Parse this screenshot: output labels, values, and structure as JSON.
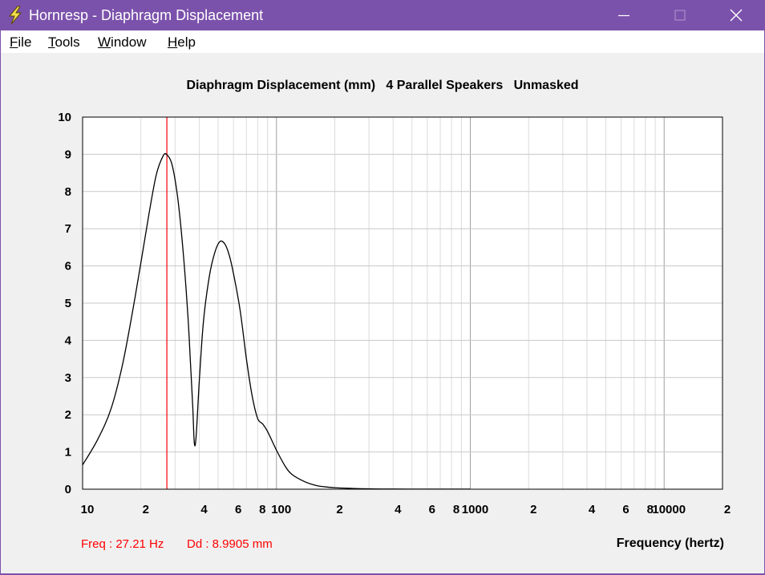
{
  "window": {
    "title": "Hornresp - Diaphragm Displacement",
    "icon": "lightning-bolt-icon",
    "controls": [
      "minimize-icon",
      "maximize-icon",
      "close-icon"
    ]
  },
  "menu": {
    "items": [
      {
        "label": "File",
        "accel": "F",
        "rest": "ile"
      },
      {
        "label": "Tools",
        "accel": "T",
        "rest": "ools"
      },
      {
        "label": "Window",
        "accel": "W",
        "rest": "indow"
      },
      {
        "label": "Help",
        "accel": "H",
        "rest": "elp"
      }
    ]
  },
  "colors": {
    "titlebar": "#7b52ab",
    "plot_bg": "#ffffff",
    "grid": "#c8c8c8",
    "curve": "#000000",
    "cursor": "#ff0000",
    "readout": "#ff0000"
  },
  "readout": {
    "freq": "Freq : 27.21 Hz",
    "dd": "Dd : 8.9905 mm"
  },
  "chart_data": {
    "type": "line",
    "title": "Diaphragm Displacement (mm)   4 Parallel Speakers   Unmasked",
    "xlabel": "Frequency (hertz)",
    "ylabel": "",
    "x_scale": "log",
    "xlim": [
      10,
      20000
    ],
    "ylim": [
      0,
      10
    ],
    "grid": true,
    "cursor_x": 27.21,
    "x_tick_labels": [
      {
        "v": 10,
        "t": "10"
      },
      {
        "v": 20,
        "t": "2"
      },
      {
        "v": 40,
        "t": "4"
      },
      {
        "v": 60,
        "t": "6"
      },
      {
        "v": 80,
        "t": "8"
      },
      {
        "v": 100,
        "t": "100"
      },
      {
        "v": 200,
        "t": "2"
      },
      {
        "v": 400,
        "t": "4"
      },
      {
        "v": 600,
        "t": "6"
      },
      {
        "v": 800,
        "t": "8"
      },
      {
        "v": 1000,
        "t": "1000"
      },
      {
        "v": 2000,
        "t": "2"
      },
      {
        "v": 4000,
        "t": "4"
      },
      {
        "v": 6000,
        "t": "6"
      },
      {
        "v": 8000,
        "t": "8"
      },
      {
        "v": 10000,
        "t": "10000"
      },
      {
        "v": 20000,
        "t": "2"
      }
    ],
    "y_ticks": [
      0,
      1,
      2,
      3,
      4,
      5,
      6,
      7,
      8,
      9,
      10
    ],
    "series": [
      {
        "x": [
          10,
          12,
          14,
          16,
          18,
          20,
          22,
          24,
          26,
          27.21,
          29,
          31,
          33,
          35,
          36,
          37,
          37.7,
          38.5,
          40,
          42,
          45,
          48,
          51,
          54,
          57,
          60,
          65,
          70,
          75,
          80,
          85,
          90,
          100,
          110,
          120,
          140,
          160,
          180,
          200,
          250,
          300,
          400,
          600,
          1000
        ],
        "y": [
          0.65,
          1.35,
          2.15,
          3.3,
          4.7,
          6.1,
          7.4,
          8.45,
          8.95,
          8.99,
          8.7,
          7.8,
          6.4,
          4.6,
          3.4,
          2.2,
          1.25,
          1.4,
          2.9,
          4.5,
          5.7,
          6.35,
          6.65,
          6.6,
          6.3,
          5.8,
          4.8,
          3.5,
          2.5,
          1.9,
          1.75,
          1.55,
          1.05,
          0.65,
          0.4,
          0.2,
          0.1,
          0.06,
          0.04,
          0.02,
          0.01,
          0.005,
          0.003,
          0.002
        ]
      }
    ]
  }
}
